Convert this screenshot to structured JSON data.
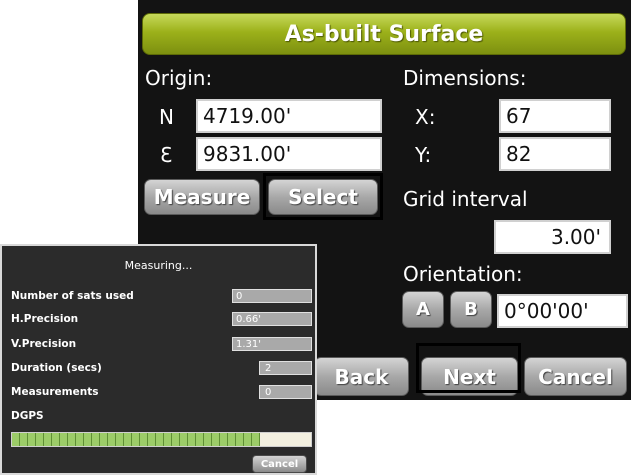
{
  "screen": {
    "title": "As-built Surface",
    "origin": {
      "label": "Origin:",
      "n_label": "N",
      "n_value": "4719.00'",
      "e_label": "Ɛ",
      "e_value": "9831.00'",
      "measure_label": "Measure",
      "select_label": "Select"
    },
    "dimensions": {
      "label": "Dimensions:",
      "x_label": "X:",
      "x_value": "67",
      "y_label": "Y:",
      "y_value": "82"
    },
    "grid": {
      "label": "Grid interval",
      "value": "3.00'"
    },
    "orientation": {
      "label": "Orientation:",
      "a_label": "A",
      "b_label": "B",
      "value": "0°00'00'"
    },
    "nav": {
      "back_label": "Back",
      "next_label": "Next",
      "cancel_label": "Cancel"
    }
  },
  "measuring": {
    "title": "Measuring...",
    "rows": [
      {
        "label": "Number of sats used",
        "value": "0"
      },
      {
        "label": "H.Precision",
        "value": "0.66'"
      },
      {
        "label": "V.Precision",
        "value": "1.31'"
      },
      {
        "label": "Duration (secs)",
        "value": "2"
      },
      {
        "label": "Measurements",
        "value": "0"
      }
    ],
    "dgps_label": "DGPS",
    "dgps_progress": 0.83,
    "cancel_label": "Cancel"
  },
  "colors": {
    "title_bar": "#9cb11a",
    "panel_background": "#131313",
    "progress_fill": "#9ccc68"
  }
}
